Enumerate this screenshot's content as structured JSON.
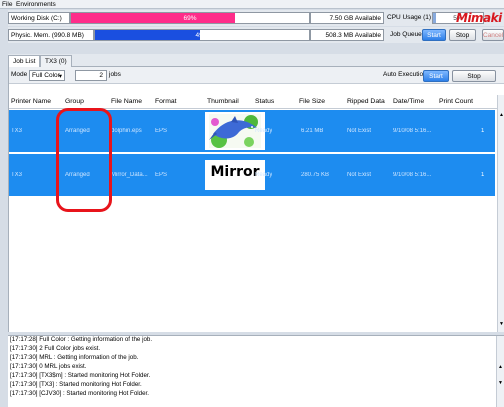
{
  "menu": {
    "items": [
      "File",
      "Environments"
    ]
  },
  "status": {
    "working_disk": {
      "label": "Working Disk (C:)",
      "percent": 69,
      "percent_text": "69%",
      "available": "7.50 GB Available",
      "color": "#ff2d8a"
    },
    "cpu": {
      "label": "CPU Usage (1)",
      "percent_text": "5%"
    },
    "brand": "Mimaki",
    "physic_mem": {
      "label": "Physic. Mem. (990.8 MB)",
      "percent": 49,
      "percent_text": "49%",
      "available": "508.3 MB Available",
      "color": "#1a4fe0"
    },
    "job_queue": {
      "label": "Job Queue",
      "start": "Start",
      "stop": "Stop"
    },
    "cancel_all": "Cancel All"
  },
  "tabs": [
    {
      "label": "Job List"
    },
    {
      "label": "TX3 (0)"
    }
  ],
  "mode": {
    "label": "Mode",
    "value": "Full Color",
    "count": "2",
    "count_unit": "jobs"
  },
  "auto_execution": {
    "label": "Auto Execution",
    "start": "Start",
    "stop": "Stop"
  },
  "table": {
    "columns": [
      "Printer Name",
      "Group",
      "File Name",
      "Format",
      "Thumbnail",
      "Status",
      "File Size",
      "Ripped Data",
      "Date/Time",
      "Print Count"
    ],
    "rows": [
      {
        "printer": "TX3",
        "group": "Arranged",
        "file": "dolphin.eps",
        "format": "EPS",
        "thumbnail": "dolphin-image",
        "status": "Ready",
        "size": "6.21 MB",
        "ripped": "Not Exist",
        "date": "9/10/08 5:16...",
        "count": "1"
      },
      {
        "printer": "TX3",
        "group": "Arranged",
        "file": "Mirror_Data...",
        "format": "EPS",
        "thumbnail": "Mirror",
        "status": "Ready",
        "size": "280.75 KB",
        "ripped": "Not Exist",
        "date": "9/10/08 5:16...",
        "count": "1"
      }
    ]
  },
  "log": [
    "[17:17:28] Full Color : Getting information of the job.",
    "[17:17:30] 2 Full Color jobs exist.",
    "[17:17:30] MRL : Getting information of the job.",
    "[17:17:30] 0 MRL jobs exist.",
    "[17:17:30] [TX3$m] : Started monitoring Hot Folder.",
    "[17:17:30] [TX3] : Started monitoring Hot Folder.",
    "[17:17:30] [CJV30] : Started monitoring Hot Folder."
  ]
}
